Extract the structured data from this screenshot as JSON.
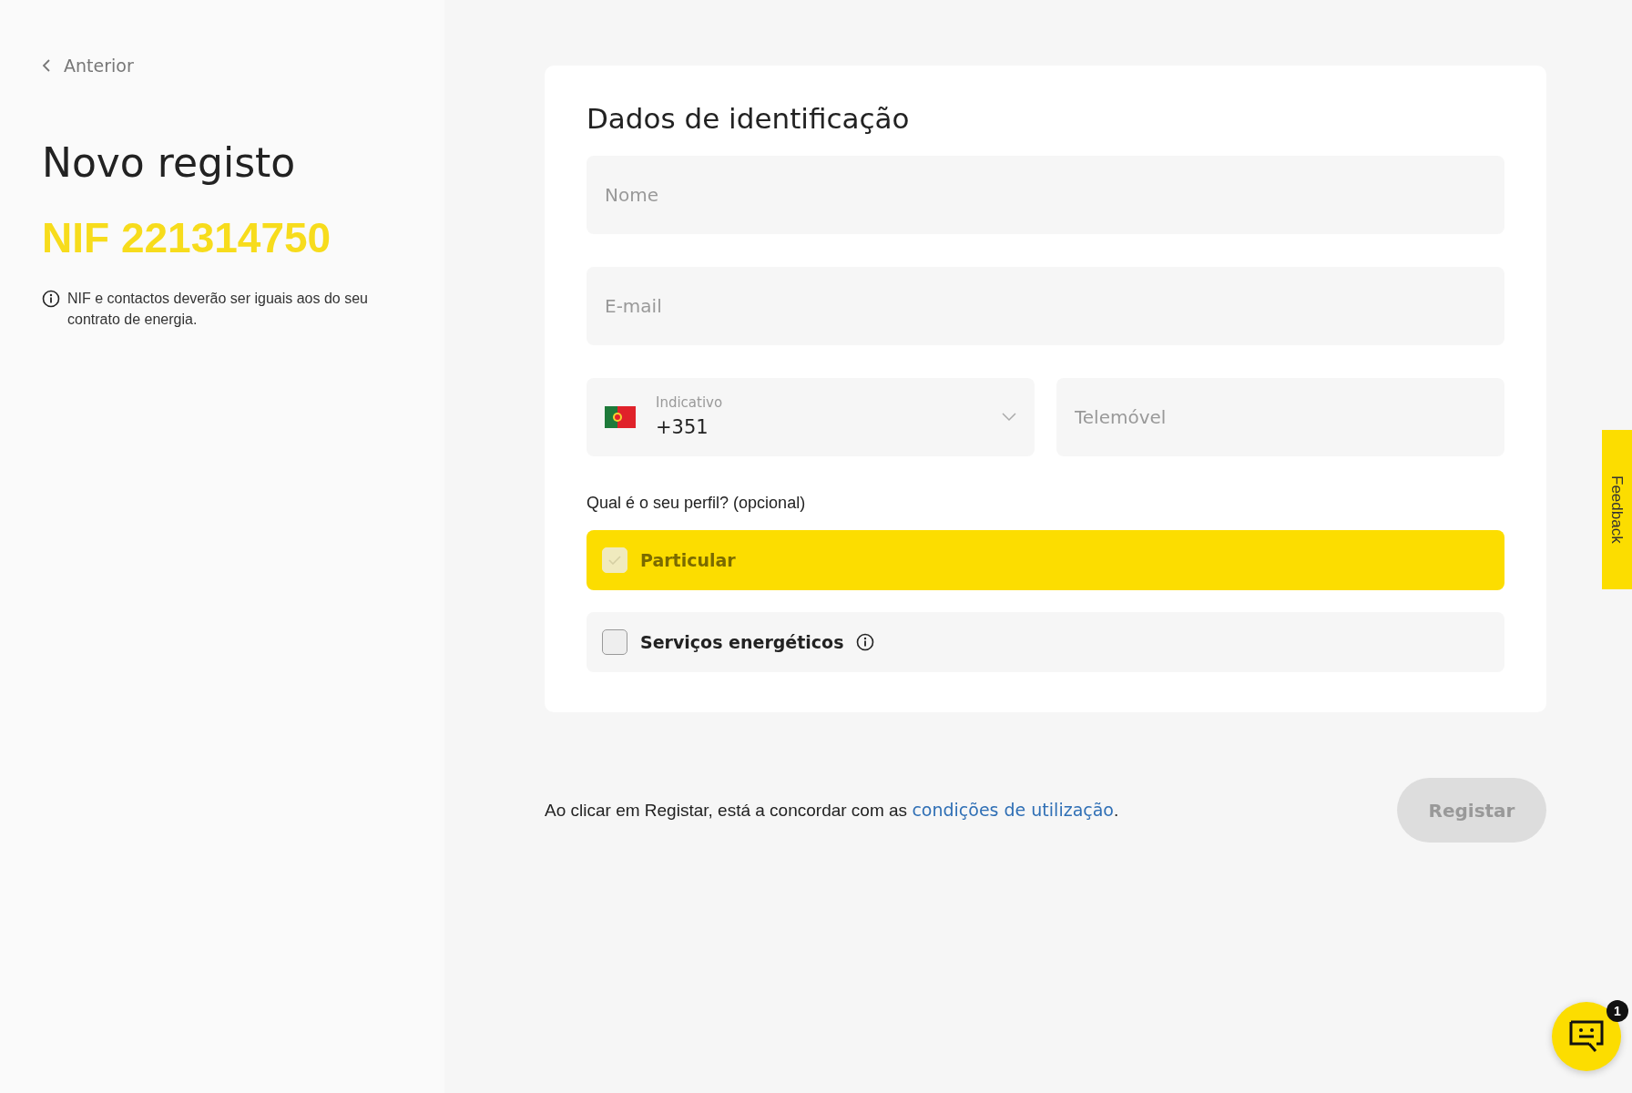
{
  "back_link": {
    "label": "Anterior"
  },
  "heading": "Novo registo",
  "nif": "NIF 221314750",
  "info_note": "NIF e contactos deverão ser iguais aos do seu contrato de energia.",
  "form": {
    "title": "Dados de identificação",
    "name_field": {
      "placeholder": "Nome"
    },
    "email_field": {
      "placeholder": "E-mail"
    },
    "country_code": {
      "label": "Indicativo",
      "value": "+351"
    },
    "phone_field": {
      "placeholder": "Telemóvel"
    },
    "profile_question": "Qual é o seu perfil? (opcional)",
    "profiles": [
      {
        "label": "Particular",
        "selected": true,
        "disabled": true,
        "info": false
      },
      {
        "label": "Serviços energéticos",
        "selected": false,
        "disabled": false,
        "info": true
      }
    ]
  },
  "terms": {
    "before": "Ao clicar em Registar, está a concordar com as ",
    "link": "condições de utilização",
    "after": "."
  },
  "register_button": {
    "label": "Registar",
    "disabled": true
  },
  "feedback_tab": {
    "label": "Feedback"
  },
  "chat_button": {
    "badge": "1"
  }
}
